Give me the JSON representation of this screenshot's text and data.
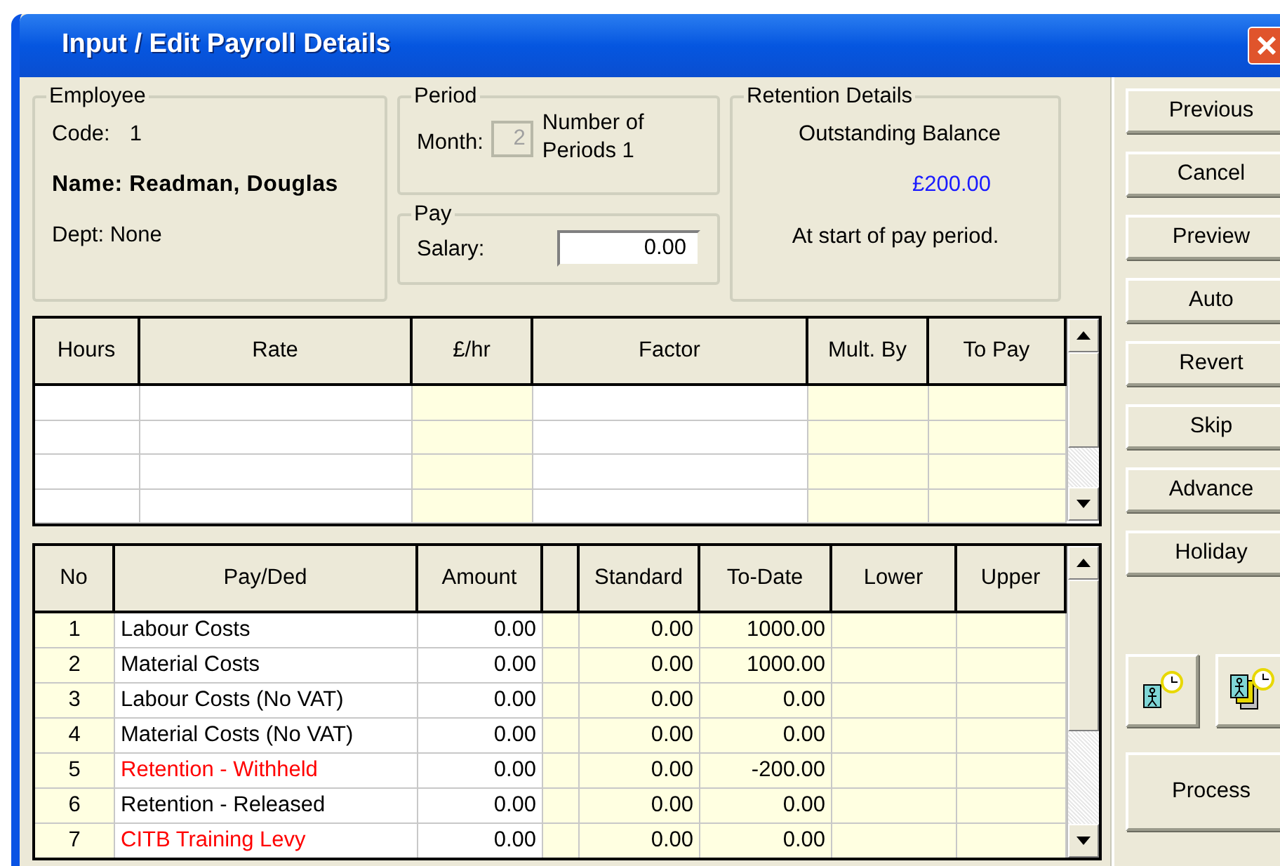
{
  "window": {
    "title": "Input / Edit Payroll Details"
  },
  "employee": {
    "title": "Employee",
    "code_label": "Code:",
    "code": "1",
    "name": "Name: Readman, Douglas",
    "dept": "Dept: None"
  },
  "period": {
    "title": "Period",
    "month_label": "Month:",
    "month": "2",
    "month_disabled": true,
    "periods": "Number of Periods 1"
  },
  "pay": {
    "title": "Pay",
    "salary_label": "Salary:",
    "salary": "0.00"
  },
  "retention": {
    "title": "Retention Details",
    "label": "Outstanding Balance",
    "balance": "£200.00",
    "note": "At start of pay period."
  },
  "hours_grid": {
    "columns": [
      {
        "label": "Hours",
        "editable": true
      },
      {
        "label": "Rate",
        "editable": true
      },
      {
        "label": "£/hr",
        "editable": false
      },
      {
        "label": "Factor",
        "editable": true
      },
      {
        "label": "Mult. By",
        "editable": false
      },
      {
        "label": "To Pay",
        "editable": false
      }
    ],
    "rows": [
      {
        "kind": "blank"
      },
      {
        "kind": "blank"
      },
      {
        "kind": "blank"
      },
      {
        "kind": "blank"
      }
    ]
  },
  "pay_grid": {
    "columns": [
      {
        "label": "No",
        "editable": false
      },
      {
        "label": "Pay/Ded",
        "editable": true
      },
      {
        "label": "Amount",
        "editable": true
      },
      {
        "editable": false
      },
      {
        "label": "Standard",
        "editable": false
      },
      {
        "label": "To-Date",
        "editable": false
      },
      {
        "label": "Lower",
        "editable": false
      },
      {
        "label": "Upper",
        "editable": false
      }
    ],
    "rows": [
      {
        "no": "1",
        "name": "Labour Costs",
        "color": "#000000",
        "amount": "0.00",
        "standard": "0.00",
        "to_date": "1000.00"
      },
      {
        "no": "2",
        "name": "Material Costs",
        "color": "#000000",
        "amount": "0.00",
        "standard": "0.00",
        "to_date": "1000.00"
      },
      {
        "no": "3",
        "name": "Labour Costs  (No VAT)",
        "color": "#000000",
        "amount": "0.00",
        "standard": "0.00",
        "to_date": "0.00"
      },
      {
        "no": "4",
        "name": "Material Costs (No VAT)",
        "color": "#000000",
        "amount": "0.00",
        "standard": "0.00",
        "to_date": "0.00"
      },
      {
        "no": "5",
        "name": "Retention - Withheld",
        "color": "#ff0000",
        "amount": "0.00",
        "standard": "0.00",
        "to_date": "-200.00"
      },
      {
        "no": "6",
        "name": "Retention - Released",
        "color": "#000000",
        "amount": "0.00",
        "standard": "0.00",
        "to_date": "0.00"
      },
      {
        "no": "7",
        "name": "CITB Training Levy",
        "color": "#ff0000",
        "amount": "0.00",
        "standard": "0.00",
        "to_date": "0.00"
      }
    ]
  },
  "buttons": [
    {
      "label": "Previous"
    },
    {
      "label": "Cancel"
    },
    {
      "label": "Preview"
    },
    {
      "label": "Auto"
    },
    {
      "label": "Revert"
    },
    {
      "label": "Skip"
    },
    {
      "label": "Advance"
    },
    {
      "label": "Holiday"
    }
  ],
  "icon_buttons": [
    {
      "kind": "single"
    },
    {
      "kind": "multiple"
    }
  ],
  "process_button": "Process"
}
